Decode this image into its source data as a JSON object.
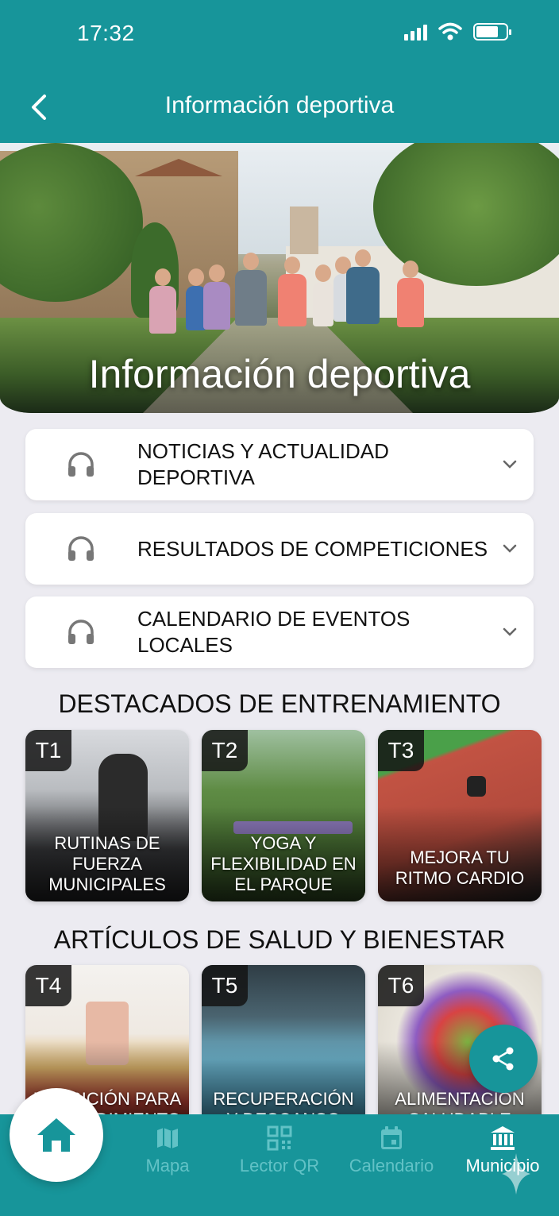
{
  "status": {
    "time": "17:32"
  },
  "header": {
    "title": "Información deportiva"
  },
  "hero": {
    "title": "Información deportiva"
  },
  "accordions": [
    {
      "label": "NOTICIAS Y ACTUALIDAD DEPORTIVA"
    },
    {
      "label": "RESULTADOS DE COMPETICIONES"
    },
    {
      "label": "CALENDARIO DE EVENTOS LOCALES"
    }
  ],
  "training": {
    "title": "DESTACADOS DE ENTRENAMIENTO",
    "cards": [
      {
        "badge": "T1",
        "text": "RUTINAS DE FUERZA MUNICIPALES"
      },
      {
        "badge": "T2",
        "text": "YOGA Y FLEXIBILIDAD EN EL PARQUE"
      },
      {
        "badge": "T3",
        "text": "MEJORA TU RITMO CARDIO"
      }
    ]
  },
  "health": {
    "title": "ARTÍCULOS DE SALUD Y BIENESTAR",
    "cards": [
      {
        "badge": "T4",
        "text": "NUTRICIÓN PARA EL RENDIMIENTO"
      },
      {
        "badge": "T5",
        "text": "RECUPERACIÓN Y DESCANSO"
      },
      {
        "badge": "T6",
        "text": "ALIMENTACIÓN SALUDABLE"
      }
    ]
  },
  "nav": {
    "items": [
      {
        "label": "Mapa",
        "icon": "map-icon"
      },
      {
        "label": "Lector QR",
        "icon": "qr-code-icon"
      },
      {
        "label": "Calendario",
        "icon": "calendar-icon"
      },
      {
        "label": "Municipio",
        "icon": "town-hall-icon"
      }
    ],
    "active": "Municipio"
  },
  "colors": {
    "primary": "#17959a",
    "background": "#ecebf1",
    "nav_inactive": "#62c2c6"
  }
}
